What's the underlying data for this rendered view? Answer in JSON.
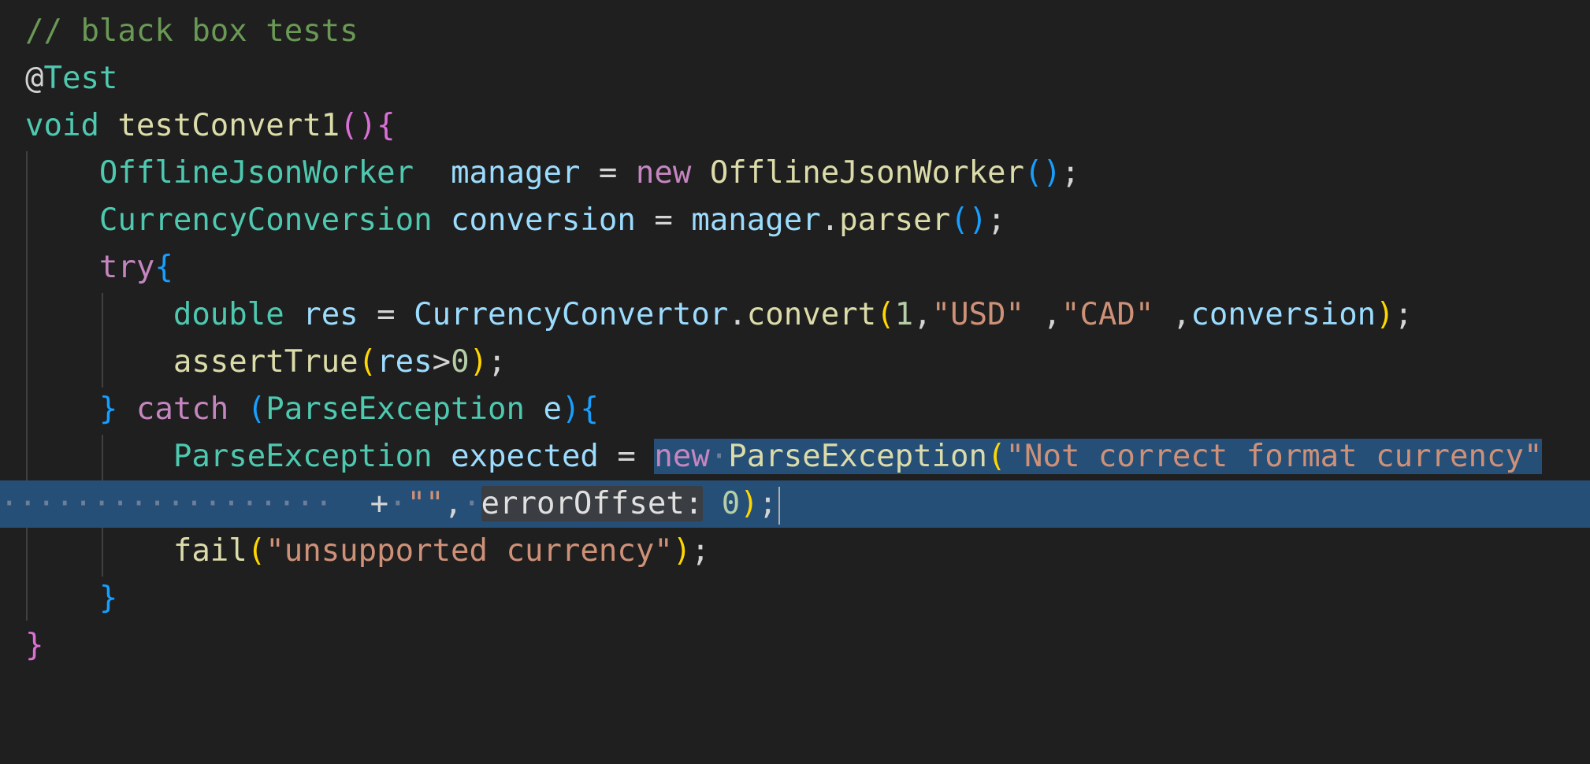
{
  "editor": {
    "lines": [
      {
        "comment": "// black box tests"
      },
      {
        "at": "@",
        "annotation": "Test"
      },
      {
        "return_type": "void",
        "method_name": "testConvert1",
        "open_paren": "(",
        "close_paren": ")",
        "open_brace": "{"
      },
      {
        "type": "OfflineJsonWorker",
        "spacing": "  ",
        "var": "manager",
        "eq": " = ",
        "new_kw": "new",
        "ctor": "OfflineJsonWorker",
        "args": "()",
        "semi": ";"
      },
      {
        "type": "CurrencyConversion",
        "var": "conversion",
        "eq": " = ",
        "obj": "manager",
        "dot": ".",
        "method": "parser",
        "args": "()",
        "semi": ";"
      },
      {
        "keyword": "try",
        "brace": "{"
      },
      {
        "type": "double",
        "var": "res",
        "eq": " = ",
        "class": "CurrencyConvertor",
        "dot": ".",
        "method": "convert",
        "open_paren": "(",
        "num": "1",
        "comma1": ",",
        "str1": "\"USD\"",
        "sep": " ,",
        "str2": "\"CAD\"",
        "sep2": " ,",
        "arg": "conversion",
        "close_paren": ")",
        "semi": ";"
      },
      {
        "fn": "assertTrue",
        "open_paren": "(",
        "var": "res",
        "op": ">",
        "num": "0",
        "close_paren": ")",
        "semi": ";"
      },
      {
        "close_brace": "}",
        "keyword": "catch",
        "open_paren": "(",
        "type": "ParseException",
        "param": "e",
        "close_paren": ")",
        "open_brace": "{"
      },
      {
        "type": "ParseException",
        "var": "expected",
        "eq": " = ",
        "new_kw": "new",
        "ctor": "ParseException",
        "open_paren": "(",
        "str": "\"Not correct format currency\""
      },
      {
        "plus": "+",
        "str": "\"\"",
        "comma": ",",
        "hint": "errorOffset:",
        "num": "0",
        "close_paren": ")",
        "semi": ";"
      },
      {
        "fn": "fail",
        "open_paren": "(",
        "str": "\"unsupported currency\"",
        "close_paren": ")",
        "semi": ";"
      },
      {
        "close_brace": "}"
      },
      {
        "close_brace": "}"
      }
    ]
  },
  "colors": {
    "background": "#1f1f1f",
    "selection": "#264f78",
    "comment": "#6a9955",
    "keyword": "#569cd6",
    "control": "#c586c0",
    "type": "#4ec9b0",
    "variable": "#9cdcfe",
    "function": "#dcdcaa",
    "string": "#ce9178",
    "number": "#b5cea8"
  }
}
